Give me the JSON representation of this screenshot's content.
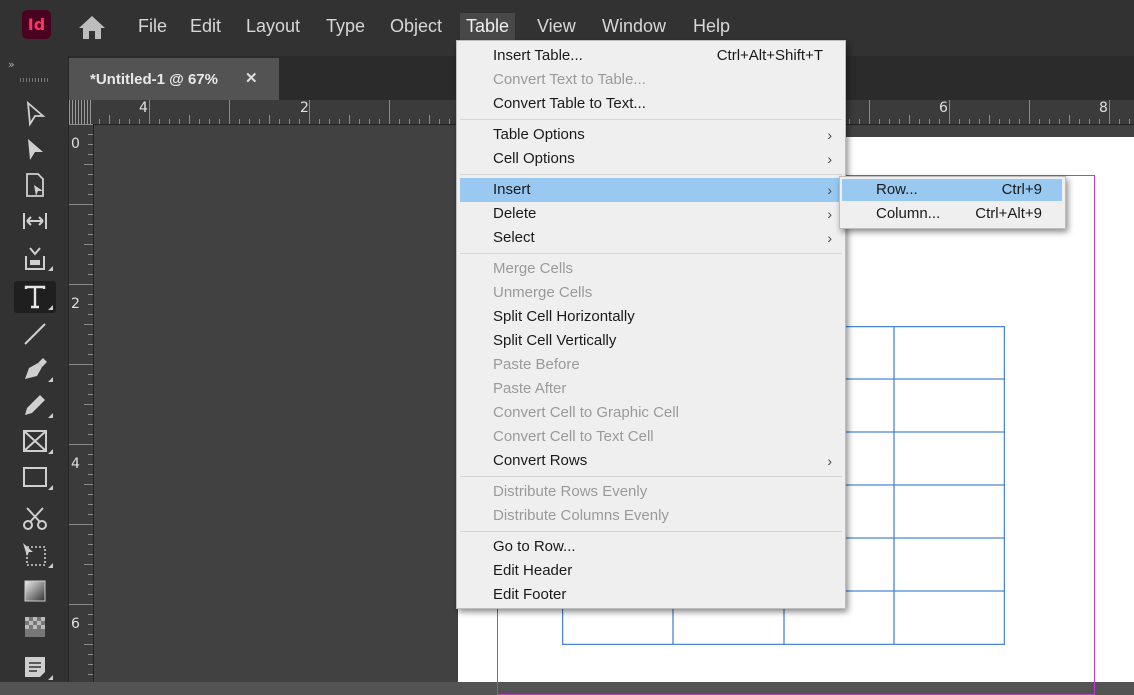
{
  "app": {
    "logo_text": "Id"
  },
  "menubar": {
    "items": [
      {
        "label": "File"
      },
      {
        "label": "Edit"
      },
      {
        "label": "Layout"
      },
      {
        "label": "Type"
      },
      {
        "label": "Object"
      },
      {
        "label": "Table"
      },
      {
        "label": "View"
      },
      {
        "label": "Window"
      },
      {
        "label": "Help"
      }
    ],
    "active": "Table"
  },
  "toolbar": {
    "collapse_label": "»",
    "tools": [
      {
        "name": "selection-tool",
        "icon": "arrow-outline-icon"
      },
      {
        "name": "direct-selection-tool",
        "icon": "arrow-filled-icon"
      },
      {
        "name": "page-tool",
        "icon": "page-icon"
      },
      {
        "name": "gap-tool",
        "icon": "gap-icon"
      },
      {
        "name": "content-collector-tool",
        "icon": "content-collector-icon"
      },
      {
        "name": "type-tool",
        "icon": "type-icon",
        "selected": true
      },
      {
        "name": "line-tool",
        "icon": "line-icon"
      },
      {
        "name": "pen-tool",
        "icon": "pen-icon"
      },
      {
        "name": "pencil-tool",
        "icon": "pencil-icon"
      },
      {
        "name": "rectangle-frame-tool",
        "icon": "frame-icon"
      },
      {
        "name": "rectangle-tool",
        "icon": "rectangle-icon"
      },
      {
        "name": "scissors-tool",
        "icon": "scissors-icon"
      },
      {
        "name": "free-transform-tool",
        "icon": "free-transform-icon"
      },
      {
        "name": "gradient-swatch-tool",
        "icon": "gradient-icon"
      },
      {
        "name": "gradient-feather-tool",
        "icon": "gradient-feather-icon"
      },
      {
        "name": "note-tool",
        "icon": "note-icon"
      }
    ]
  },
  "document_tab": {
    "title": "*Untitled-1 @ 67%",
    "close": "✕"
  },
  "rulers": {
    "horizontal_labels": [
      "4",
      "2",
      "6",
      "8"
    ],
    "vertical_labels": [
      "0",
      "2",
      "4",
      "6"
    ]
  },
  "table_menu": {
    "items": [
      {
        "label": "Insert Table...",
        "shortcut": "Ctrl+Alt+Shift+T",
        "enabled": true
      },
      {
        "label": "Convert Text to Table...",
        "enabled": false
      },
      {
        "label": "Convert Table to Text...",
        "enabled": true
      },
      {
        "label": "Table Options",
        "submenu": true,
        "enabled": true
      },
      {
        "label": "Cell Options",
        "submenu": true,
        "enabled": true
      },
      {
        "label": "Insert",
        "submenu": true,
        "enabled": true,
        "highlighted": true
      },
      {
        "label": "Delete",
        "submenu": true,
        "enabled": true
      },
      {
        "label": "Select",
        "submenu": true,
        "enabled": true
      },
      {
        "label": "Merge Cells",
        "enabled": false
      },
      {
        "label": "Unmerge Cells",
        "enabled": false
      },
      {
        "label": "Split Cell Horizontally",
        "enabled": true
      },
      {
        "label": "Split Cell Vertically",
        "enabled": true
      },
      {
        "label": "Paste Before",
        "enabled": false
      },
      {
        "label": "Paste After",
        "enabled": false
      },
      {
        "label": "Convert Cell to Graphic Cell",
        "enabled": false
      },
      {
        "label": "Convert Cell to Text Cell",
        "enabled": false
      },
      {
        "label": "Convert Rows",
        "submenu": true,
        "enabled": true
      },
      {
        "label": "Distribute Rows Evenly",
        "enabled": false
      },
      {
        "label": "Distribute Columns Evenly",
        "enabled": false
      },
      {
        "label": "Go to Row...",
        "enabled": true
      },
      {
        "label": "Edit Header",
        "enabled": true
      },
      {
        "label": "Edit Footer",
        "enabled": true
      }
    ],
    "submenu_arrow": "›"
  },
  "insert_submenu": {
    "items": [
      {
        "label": "Row...",
        "shortcut": "Ctrl+9",
        "highlighted": true
      },
      {
        "label": "Column...",
        "shortcut": "Ctrl+Alt+9"
      }
    ]
  },
  "colors": {
    "menu_highlight": "#99c9f1",
    "table_stroke": "#4a86d8",
    "margin_guide": "#c23bd0",
    "app_logo_bg": "#49021f",
    "app_logo_fg": "#ff3366"
  }
}
